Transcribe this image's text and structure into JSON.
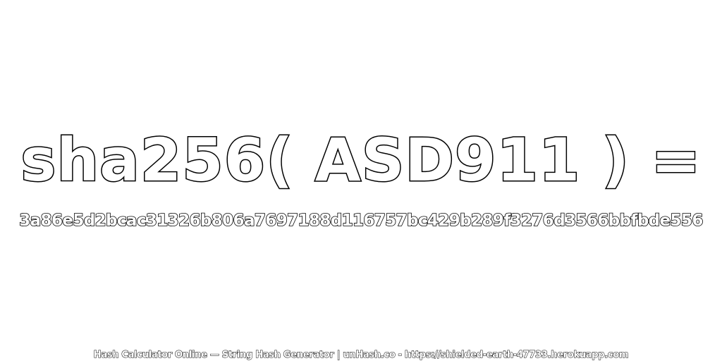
{
  "title": "sha256( ASD911 ) =",
  "hash": "3a86e5d2bcac31326b806a7697188d116757bc429b289f3276d3566bbfbde556",
  "footer": "Hash Calculator Online — String Hash Generator | unHash.co - https://shielded-earth-47733.herokuapp.com",
  "colors": {
    "background": "#ffffff",
    "text_fill": "#ffffff",
    "text_stroke": "#000000"
  }
}
